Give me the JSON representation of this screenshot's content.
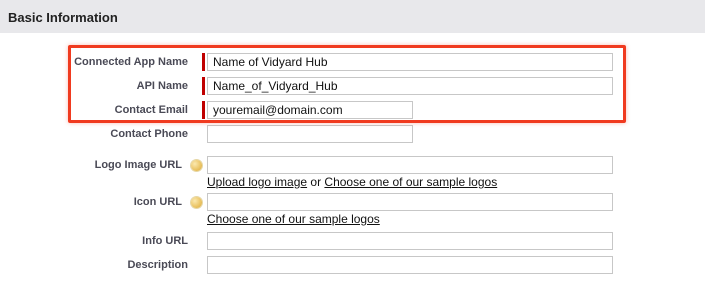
{
  "section": {
    "title": "Basic Information"
  },
  "fields": {
    "connected_app_name": {
      "label": "Connected App Name",
      "value": "Name of Vidyard Hub"
    },
    "api_name": {
      "label": "API Name",
      "value": "Name_of_Vidyard_Hub"
    },
    "contact_email": {
      "label": "Contact Email",
      "value": "youremail@domain.com"
    },
    "contact_phone": {
      "label": "Contact Phone",
      "value": ""
    },
    "logo_image_url": {
      "label": "Logo Image URL",
      "value": ""
    },
    "icon_url": {
      "label": "Icon URL",
      "value": ""
    },
    "info_url": {
      "label": "Info URL",
      "value": ""
    },
    "description": {
      "label": "Description",
      "value": ""
    }
  },
  "links": {
    "upload_logo": "Upload logo image",
    "or_text": " or ",
    "choose_sample_logos": "Choose one of our sample logos",
    "choose_sample_icons": "Choose one of our sample logos"
  },
  "icons": {
    "help": "help-icon"
  },
  "colors": {
    "header_bg": "#e8e8eb",
    "required_marker": "#c00000",
    "highlight_border": "#f03a1f",
    "label_text": "#4a4a56"
  }
}
